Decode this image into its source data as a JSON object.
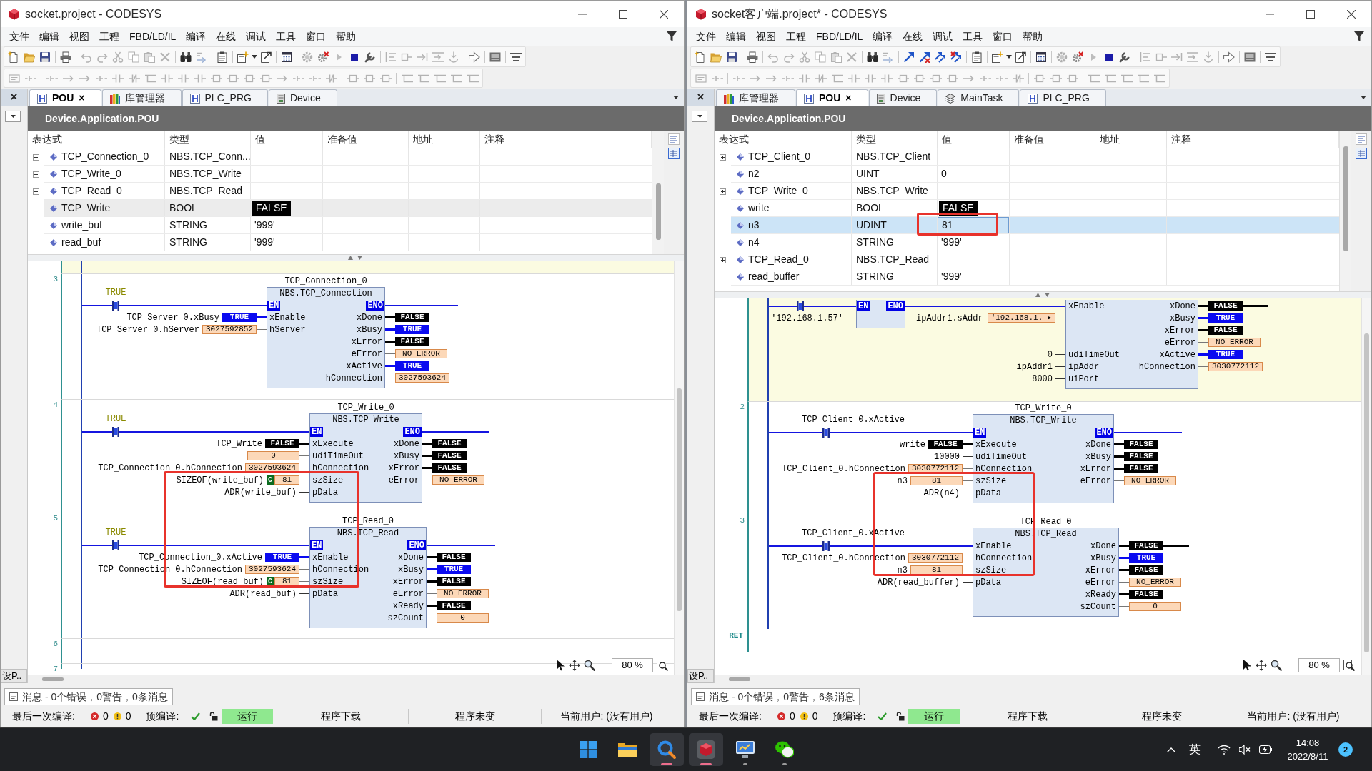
{
  "windows": [
    {
      "title": "socket.project - CODESYS",
      "focused": false,
      "online_commands": false,
      "menu": [
        "文件",
        "编辑",
        "视图",
        "工程",
        "FBD/LD/IL",
        "编译",
        "在线",
        "调试",
        "工具",
        "窗口",
        "帮助"
      ],
      "side_panel": {
        "close": "×",
        "tab": "设P.."
      },
      "tabs": [
        {
          "label": "POU",
          "kind": "pou",
          "selected": true,
          "close": "×"
        },
        {
          "label": "库管理器",
          "kind": "library",
          "selected": false
        },
        {
          "label": "PLC_PRG",
          "kind": "pou",
          "selected": false
        },
        {
          "label": "Device",
          "kind": "device",
          "selected": false
        }
      ],
      "editor_title": "Device.Application.POU",
      "table": {
        "columns": [
          "表达式",
          "类型",
          "值",
          "准备值",
          "地址",
          "注释"
        ],
        "rows": [
          {
            "kind": "instance",
            "expanded": false,
            "expression": "TCP_Connection_0",
            "type": "NBS.TCP_Conn...",
            "selected": false,
            "editing": false
          },
          {
            "kind": "instance",
            "expanded": false,
            "expression": "TCP_Write_0",
            "type": "NBS.TCP_Write",
            "selected": false,
            "editing": false
          },
          {
            "kind": "instance",
            "expanded": false,
            "expression": "TCP_Read_0",
            "type": "NBS.TCP_Read",
            "selected": false,
            "editing": false
          },
          {
            "kind": "bool",
            "expression": "TCP_Write",
            "type": "BOOL",
            "value": "FALSE",
            "selected": true,
            "editing": false
          },
          {
            "kind": "variable",
            "expression": "write_buf",
            "type": "STRING",
            "value": "'999'",
            "selected": false,
            "editing": false
          },
          {
            "kind": "variable",
            "expression": "read_buf",
            "type": "STRING",
            "value": "'999'",
            "selected": false,
            "editing": false
          }
        ]
      },
      "networks": [
        {
          "kind": "rung",
          "selected": true
        },
        {
          "kind": "rung",
          "number": "3",
          "selected": false,
          "contact": {
            "label": "TRUE",
            "kind": "value",
            "energized": true
          },
          "blocks": [
            {
              "instance": "TCP_Connection_0",
              "type": "NBS.TCP_Connection",
              "en": "EN",
              "eno": "ENO",
              "rows": [
                {
                  "input": {
                    "pin": "xEnable",
                    "label": "TCP_Server_0.xBusy",
                    "value": {
                      "text": "TRUE",
                      "kind": "true"
                    }
                  },
                  "output": {
                    "pin": "xDone",
                    "value": {
                      "text": "FALSE",
                      "kind": "false"
                    }
                  }
                },
                {
                  "input": {
                    "pin": "hServer",
                    "label": "TCP_Server_0.hServer",
                    "value": {
                      "text": "3027592852",
                      "kind": "data"
                    }
                  },
                  "output": {
                    "pin": "xBusy",
                    "value": {
                      "text": "TRUE",
                      "kind": "true"
                    }
                  }
                },
                {
                  "output": {
                    "pin": "xError",
                    "value": {
                      "text": "FALSE",
                      "kind": "false"
                    }
                  }
                },
                {
                  "output": {
                    "pin": "eError",
                    "value": {
                      "text": "NO ERROR",
                      "kind": "data"
                    }
                  }
                },
                {
                  "output": {
                    "pin": "xActive",
                    "value": {
                      "text": "TRUE",
                      "kind": "true"
                    }
                  }
                },
                {
                  "output": {
                    "pin": "hConnection",
                    "value": {
                      "text": "3027593624",
                      "kind": "data"
                    }
                  }
                }
              ]
            }
          ]
        },
        {
          "kind": "rung",
          "number": "4",
          "selected": false,
          "contact": {
            "label": "TRUE",
            "kind": "value",
            "energized": true
          },
          "blocks": [
            {
              "instance": "TCP_Write_0",
              "type": "NBS.TCP_Write",
              "en": "EN",
              "eno": "ENO",
              "rows": [
                {
                  "input": {
                    "pin": "xExecute",
                    "label": "TCP_Write",
                    "value": {
                      "text": "FALSE",
                      "kind": "false"
                    }
                  },
                  "output": {
                    "pin": "xDone",
                    "value": {
                      "text": "FALSE",
                      "kind": "false"
                    }
                  }
                },
                {
                  "input": {
                    "pin": "udiTimeOut",
                    "value": {
                      "text": "0",
                      "kind": "data"
                    }
                  },
                  "output": {
                    "pin": "xBusy",
                    "value": {
                      "text": "FALSE",
                      "kind": "false"
                    }
                  }
                },
                {
                  "input": {
                    "pin": "hConnection",
                    "label": "TCP_Connection_0.hConnection",
                    "value": {
                      "text": "3027593624",
                      "kind": "data"
                    }
                  },
                  "output": {
                    "pin": "xError",
                    "value": {
                      "text": "FALSE",
                      "kind": "false"
                    }
                  }
                },
                {
                  "input": {
                    "pin": "szSize",
                    "label": "SIZEOF(write_buf)",
                    "value": {
                      "text": "81",
                      "kind": "data",
                      "badge": "C"
                    }
                  },
                  "output": {
                    "pin": "eError",
                    "value": {
                      "text": "NO ERROR",
                      "kind": "data"
                    }
                  }
                },
                {
                  "input": {
                    "pin": "pData",
                    "label": "ADR(write_buf)"
                  }
                }
              ]
            }
          ]
        },
        {
          "kind": "rung",
          "number": "5",
          "selected": false,
          "contact": {
            "label": "TRUE",
            "kind": "value",
            "energized": true
          },
          "blocks": [
            {
              "instance": "TCP_Read_0",
              "type": "NBS.TCP_Read",
              "en": "EN",
              "eno": "ENO",
              "rows": [
                {
                  "input": {
                    "pin": "xEnable",
                    "label": "TCP_Connection_0.xActive",
                    "value": {
                      "text": "TRUE",
                      "kind": "true"
                    }
                  },
                  "output": {
                    "pin": "xDone",
                    "value": {
                      "text": "FALSE",
                      "kind": "false"
                    }
                  }
                },
                {
                  "input": {
                    "pin": "hConnection",
                    "label": "TCP_Connection_0.hConnection",
                    "value": {
                      "text": "3027593624",
                      "kind": "data"
                    }
                  },
                  "output": {
                    "pin": "xBusy",
                    "value": {
                      "text": "TRUE",
                      "kind": "true"
                    }
                  }
                },
                {
                  "input": {
                    "pin": "szSize",
                    "label": "SIZEOF(read_buf)",
                    "value": {
                      "text": "81",
                      "kind": "data",
                      "badge": "C"
                    }
                  },
                  "output": {
                    "pin": "xError",
                    "value": {
                      "text": "FALSE",
                      "kind": "false"
                    }
                  }
                },
                {
                  "input": {
                    "pin": "pData",
                    "label": "ADR(read_buf)"
                  },
                  "output": {
                    "pin": "eError",
                    "value": {
                      "text": "NO ERROR",
                      "kind": "data"
                    }
                  }
                },
                {
                  "output": {
                    "pin": "xReady",
                    "value": {
                      "text": "FALSE",
                      "kind": "false"
                    }
                  }
                },
                {
                  "output": {
                    "pin": "szCount",
                    "value": {
                      "text": "0",
                      "kind": "data"
                    }
                  }
                }
              ]
            }
          ]
        },
        {
          "kind": "rung",
          "number": "6",
          "selected": false
        },
        {
          "kind": "rung",
          "number": "7",
          "selected": false
        }
      ],
      "zoom": "80 %",
      "messages_tab": "消息 - 0个错误，0警告，0条消息",
      "status_bar": {
        "last_build": "最后一次编译:",
        "errors": "0",
        "warnings": "0",
        "precompile": "预编译:",
        "precompile_ok": true,
        "run_state": "运行",
        "running": true,
        "download": "程序下载",
        "program_state": "程序未变",
        "user": "当前用户: (没有用户)"
      }
    },
    {
      "title": "socket客户端.project* - CODESYS",
      "focused": true,
      "online_commands": true,
      "menu": [
        "文件",
        "编辑",
        "视图",
        "工程",
        "FBD/LD/IL",
        "编译",
        "在线",
        "调试",
        "工具",
        "窗口",
        "帮助"
      ],
      "side_panel": {
        "close": "×",
        "tab": "设P.."
      },
      "tabs": [
        {
          "label": "库管理器",
          "kind": "library",
          "selected": false
        },
        {
          "label": "POU",
          "kind": "pou",
          "selected": true,
          "close": "×"
        },
        {
          "label": "Device",
          "kind": "device",
          "selected": false
        },
        {
          "label": "MainTask",
          "kind": "task",
          "selected": false
        },
        {
          "label": "PLC_PRG",
          "kind": "pou",
          "selected": false
        }
      ],
      "editor_title": "Device.Application.POU",
      "table": {
        "columns": [
          "表达式",
          "类型",
          "值",
          "准备值",
          "地址",
          "注释"
        ],
        "rows": [
          {
            "kind": "instance",
            "expanded": false,
            "expression": "TCP_Client_0",
            "type": "NBS.TCP_Client",
            "selected": false,
            "editing": false
          },
          {
            "kind": "variable",
            "expression": "n2",
            "type": "UINT",
            "value": "0",
            "selected": false,
            "editing": false
          },
          {
            "kind": "instance",
            "expanded": false,
            "expression": "TCP_Write_0",
            "type": "NBS.TCP_Write",
            "selected": false,
            "editing": false
          },
          {
            "kind": "bool",
            "expression": "write",
            "type": "BOOL",
            "value": "FALSE",
            "selected": false,
            "editing": false
          },
          {
            "kind": "variable",
            "expression": "n3",
            "type": "UDINT",
            "value": "81",
            "selected": true,
            "editing": true
          },
          {
            "kind": "variable",
            "expression": "n4",
            "type": "STRING",
            "value": "'999'",
            "selected": false,
            "editing": false
          },
          {
            "kind": "instance",
            "expanded": false,
            "expression": "TCP_Read_0",
            "type": "NBS.TCP_Read",
            "selected": false,
            "editing": false
          },
          {
            "kind": "variable",
            "expression": "read_buffer",
            "type": "STRING",
            "value": "'999'",
            "selected": false,
            "editing": false
          }
        ]
      },
      "networks": [
        {
          "kind": "rung",
          "selected": true,
          "contact": {
            "energized": true
          },
          "blocks": [
            {
              "en": "EN",
              "eno": "ENO",
              "rows": [
                {
                  "input": {
                    "label": "'192.168.1.57'"
                  },
                  "output": {
                    "label": "ipAddr1.sAddr",
                    "value": {
                      "text": "'192.168.1. ▸",
                      "kind": "data"
                    }
                  }
                }
              ]
            },
            {
              "rows": [
                {
                  "input": {
                    "pin": "xEnable"
                  },
                  "output": {
                    "pin": "xDone",
                    "value": {
                      "text": "FALSE",
                      "kind": "false"
                    },
                    "connected": true
                  }
                },
                {
                  "output": {
                    "pin": "xBusy",
                    "value": {
                      "text": "TRUE",
                      "kind": "true"
                    }
                  }
                },
                {
                  "output": {
                    "pin": "xError",
                    "value": {
                      "text": "FALSE",
                      "kind": "false"
                    }
                  }
                },
                {
                  "output": {
                    "pin": "eError",
                    "value": {
                      "text": "NO ERROR",
                      "kind": "data"
                    }
                  }
                },
                {
                  "input": {
                    "pin": "udiTimeOut",
                    "label": "0"
                  },
                  "output": {
                    "pin": "xActive",
                    "value": {
                      "text": "TRUE",
                      "kind": "true"
                    }
                  }
                },
                {
                  "input": {
                    "pin": "ipAddr",
                    "label": "ipAddr1"
                  },
                  "output": {
                    "pin": "hConnection",
                    "value": {
                      "text": "3030772112",
                      "kind": "data"
                    }
                  }
                },
                {
                  "input": {
                    "pin": "uiPort",
                    "label": "8000"
                  }
                }
              ]
            }
          ]
        },
        {
          "kind": "rung",
          "number": "2",
          "selected": false,
          "contact": {
            "label": "TCP_Client_0.xActive",
            "kind": "variable",
            "energized": true
          },
          "blocks": [
            {
              "instance": "TCP_Write_0",
              "type": "NBS.TCP_Write",
              "en": "EN",
              "eno": "ENO",
              "rows": [
                {
                  "input": {
                    "pin": "xExecute",
                    "label": "write",
                    "value": {
                      "text": "FALSE",
                      "kind": "false"
                    }
                  },
                  "output": {
                    "pin": "xDone",
                    "value": {
                      "text": "FALSE",
                      "kind": "false"
                    }
                  }
                },
                {
                  "input": {
                    "pin": "udiTimeOut",
                    "label": "10000"
                  },
                  "output": {
                    "pin": "xBusy",
                    "value": {
                      "text": "FALSE",
                      "kind": "false"
                    }
                  }
                },
                {
                  "input": {
                    "pin": "hConnection",
                    "label": "TCP_Client_0.hConnection",
                    "value": {
                      "text": "3030772112",
                      "kind": "data"
                    }
                  },
                  "output": {
                    "pin": "xError",
                    "value": {
                      "text": "FALSE",
                      "kind": "false"
                    }
                  }
                },
                {
                  "input": {
                    "pin": "szSize",
                    "label": "n3",
                    "value": {
                      "text": "81",
                      "kind": "data"
                    }
                  },
                  "output": {
                    "pin": "eError",
                    "value": {
                      "text": "NO_ERROR",
                      "kind": "data"
                    }
                  }
                },
                {
                  "input": {
                    "pin": "pData",
                    "label": "ADR(n4)"
                  }
                }
              ]
            }
          ]
        },
        {
          "kind": "rung",
          "number": "3",
          "selected": false,
          "contact": {
            "label": "TCP_Client_0.xActive",
            "kind": "variable",
            "energized": true
          },
          "blocks": [
            {
              "instance": "TCP_Read_0",
              "type": "NBS.TCP_Read",
              "rows": [
                {
                  "input": {
                    "pin": "xEnable"
                  },
                  "output": {
                    "pin": "xDone",
                    "value": {
                      "text": "FALSE",
                      "kind": "false"
                    },
                    "connected": true
                  }
                },
                {
                  "input": {
                    "pin": "hConnection",
                    "label": "TCP_Client_0.hConnection",
                    "value": {
                      "text": "3030772112",
                      "kind": "data"
                    }
                  },
                  "output": {
                    "pin": "xBusy",
                    "value": {
                      "text": "TRUE",
                      "kind": "true"
                    }
                  }
                },
                {
                  "input": {
                    "pin": "szSize",
                    "label": "n3",
                    "value": {
                      "text": "81",
                      "kind": "data"
                    }
                  },
                  "output": {
                    "pin": "xError",
                    "value": {
                      "text": "FALSE",
                      "kind": "false"
                    }
                  }
                },
                {
                  "input": {
                    "pin": "pData",
                    "label": "ADR(read_buffer)"
                  },
                  "output": {
                    "pin": "eError",
                    "value": {
                      "text": "NO_ERROR",
                      "kind": "data"
                    }
                  }
                },
                {
                  "output": {
                    "pin": "xReady",
                    "value": {
                      "text": "FALSE",
                      "kind": "false"
                    }
                  }
                },
                {
                  "output": {
                    "pin": "szCount",
                    "value": {
                      "text": "0",
                      "kind": "data"
                    }
                  }
                }
              ]
            }
          ]
        },
        {
          "kind": "return",
          "label": "RET"
        }
      ],
      "zoom": "80 %",
      "messages_tab": "消息 - 0个错误，0警告，6条消息",
      "status_bar": {
        "last_build": "最后一次编译:",
        "errors": "0",
        "warnings": "0",
        "precompile": "预编译:",
        "precompile_ok": true,
        "run_state": "运行",
        "running": true,
        "download": "程序下载",
        "program_state": "程序未变",
        "user": "当前用户: (没有用户)"
      }
    }
  ],
  "taskbar": {
    "items": [
      {
        "open": false,
        "focused": false
      },
      {
        "open": false,
        "focused": false
      },
      {
        "open": true,
        "focused": true
      },
      {
        "open": true,
        "focused": true
      },
      {
        "open": true,
        "focused": false
      },
      {
        "open": true,
        "focused": false
      }
    ],
    "ime": "英",
    "time": "14:08",
    "date": "2022/8/11",
    "notifications": "2"
  }
}
